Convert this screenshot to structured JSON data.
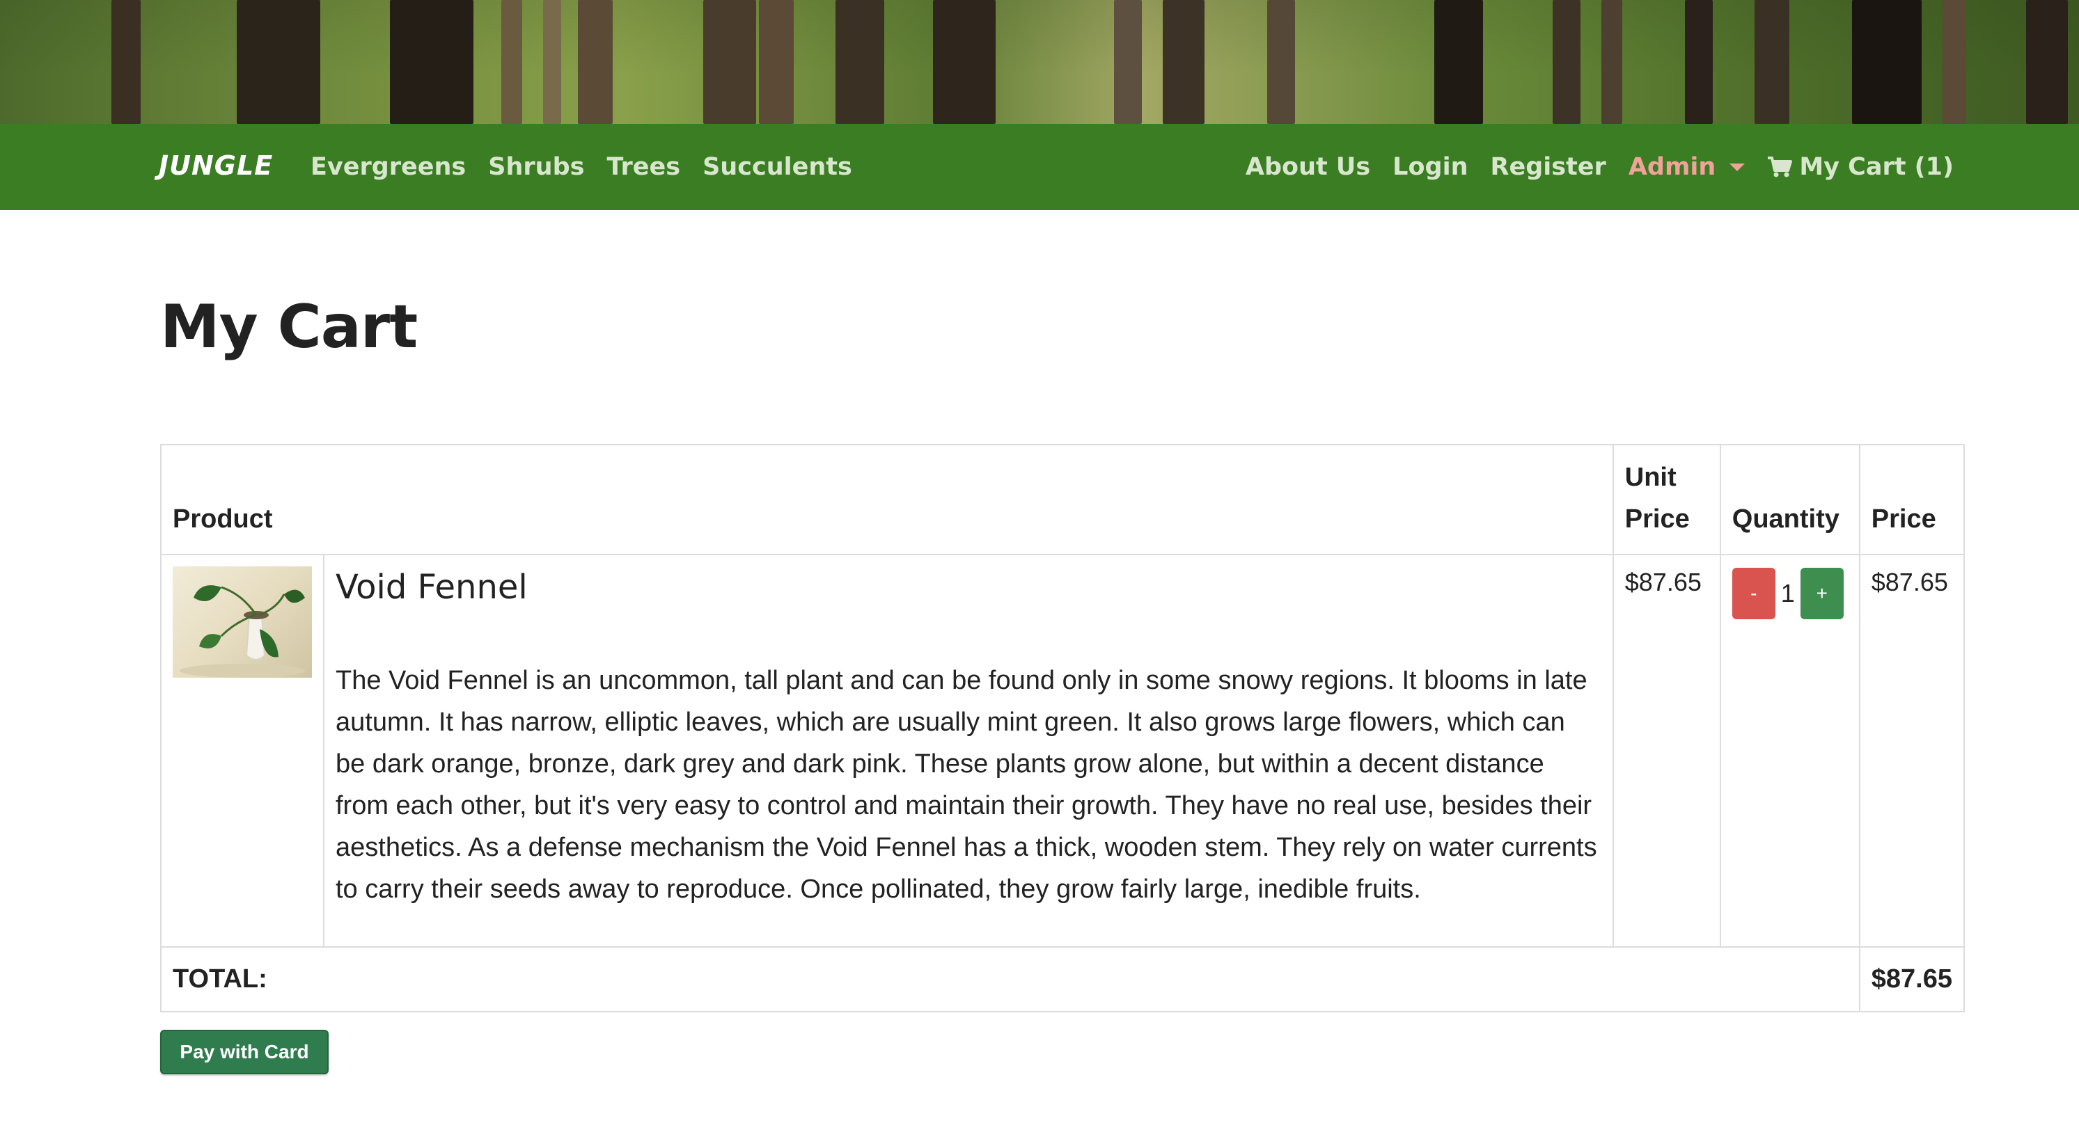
{
  "nav": {
    "brand": "JUNGLE",
    "categories": [
      "Evergreens",
      "Shrubs",
      "Trees",
      "Succulents"
    ],
    "right_links": [
      "About Us",
      "Login",
      "Register"
    ],
    "admin_label": "Admin",
    "cart_label": "My Cart (1)",
    "bar_color": "#3a7d22",
    "admin_color": "#f0a29b"
  },
  "page": {
    "title": "My Cart"
  },
  "table": {
    "headers": {
      "product": "Product",
      "unit_price": "Unit Price",
      "quantity": "Quantity",
      "price": "Price"
    },
    "items": [
      {
        "name": "Void Fennel",
        "description": "The Void Fennel is an uncommon, tall plant and can be found only in some snowy regions. It blooms in late autumn. It has narrow, elliptic leaves, which are usually mint green. It also grows large flowers, which can be dark orange, bronze, dark grey and dark pink. These plants grow alone, but within a decent distance from each other, but it's very easy to control and maintain their growth. They have no real use, besides their aesthetics. As a defense mechanism the Void Fennel has a thick, wooden stem. They rely on water currents to carry their seeds away to reproduce. Once pollinated, they grow fairly large, inedible fruits.",
        "unit_price": "$87.65",
        "quantity": "1",
        "price": "$87.65",
        "minus_label": "-",
        "plus_label": "+"
      }
    ],
    "total_label": "TOTAL:",
    "total_value": "$87.65"
  },
  "actions": {
    "pay_label": "Pay with Card"
  }
}
